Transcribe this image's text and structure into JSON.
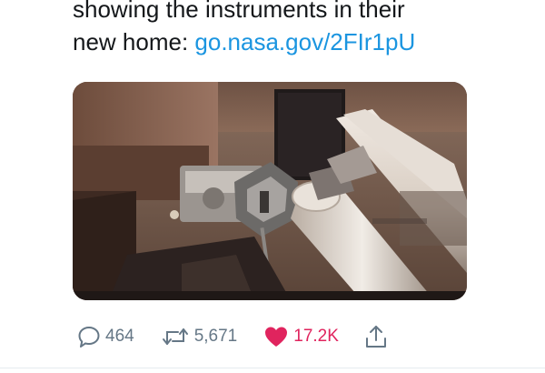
{
  "tweet": {
    "text_line_1": "showing the instruments in their",
    "text_line_2_prefix": "new home: ",
    "link_text": "go.nasa.gov/2FIr1pU"
  },
  "actions": {
    "reply_count": "464",
    "retweet_count": "5,671",
    "like_count": "17.2K",
    "liked": true
  },
  "icons": {
    "reply": "speech-bubble-icon",
    "retweet": "retweet-arrows-icon",
    "like": "heart-icon",
    "share": "share-upload-icon"
  },
  "colors": {
    "text": "#14171a",
    "link": "#1b95e0",
    "muted": "#657786",
    "like": "#e0245e"
  }
}
